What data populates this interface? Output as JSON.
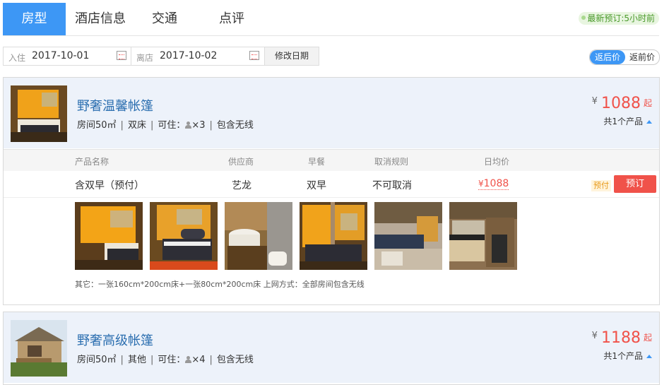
{
  "tabs": [
    "房型",
    "酒店信息",
    "交通",
    "点评"
  ],
  "recent_booking": "最新预订:5小时前",
  "dates": {
    "checkin_label": "入住",
    "checkin": "2017-10-01",
    "checkout_label": "离店",
    "checkout": "2017-10-02",
    "modify": "修改日期"
  },
  "price_toggle": {
    "after": "返后价",
    "before": "返前价"
  },
  "colors": {
    "accent": "#3d97f5",
    "price": "#f0524a",
    "title": "#2c6fb0"
  },
  "rooms": [
    {
      "name": "野奢温馨帐篷",
      "area": "房间50㎡",
      "bed": "双床",
      "occ_label": "可住：",
      "occ": "×3",
      "wifi": "包含无线",
      "yen": "¥",
      "price": "1088",
      "from": "起",
      "count": "共1个产品",
      "columns": [
        "产品名称",
        "供应商",
        "早餐",
        "取消规则",
        "日均价"
      ],
      "product": {
        "name": "含双早（预付）",
        "supplier": "艺龙",
        "breakfast": "双早",
        "cancel": "不可取消",
        "yen": "¥",
        "price": "1088",
        "badge": "预付",
        "book": "预订"
      },
      "photos": [
        "tent-interior-photo",
        "bed-photo",
        "bathroom-photo",
        "bedroom-photo",
        "tub-photo",
        "kitchen-photo"
      ],
      "other": "其它：一张160cm*200cm床+一张80cm*200cm床 上网方式：全部房间包含无线"
    },
    {
      "name": "野奢高级帐篷",
      "area": "房间50㎡",
      "bed": "其他",
      "occ_label": "可住：",
      "occ": "×4",
      "wifi": "包含无线",
      "yen": "¥",
      "price": "1188",
      "from": "起",
      "count": "共1个产品"
    }
  ]
}
